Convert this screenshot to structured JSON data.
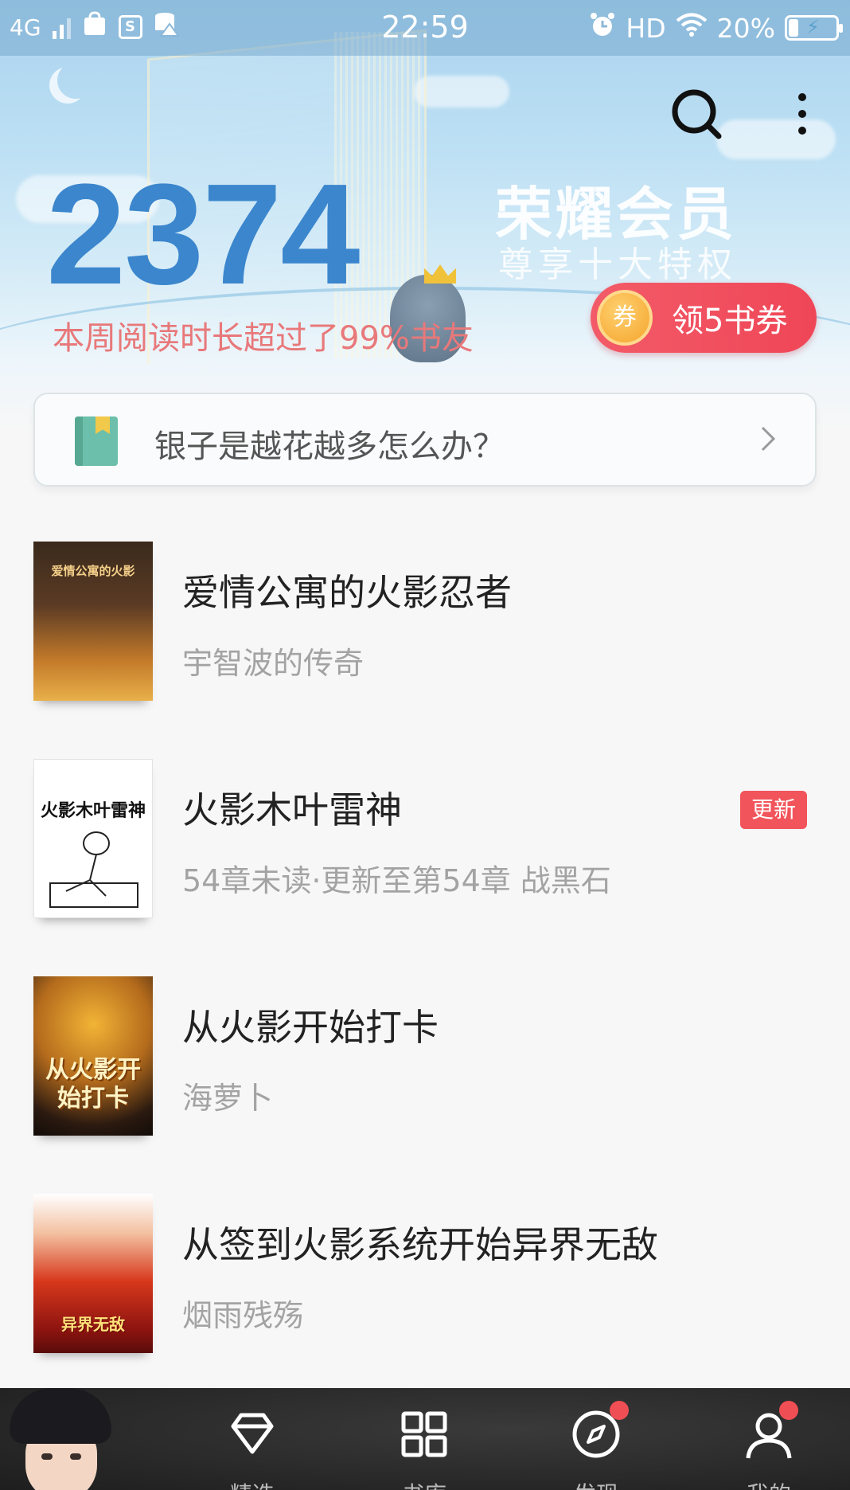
{
  "status_bar": {
    "network": "4G",
    "time": "22:59",
    "hd": "HD",
    "battery_percent": "20%",
    "battery_level": 0.2
  },
  "hero": {
    "reading_minutes": "2374",
    "reading_rank_text": "本周阅读时长超过了99%书友",
    "vip_title": "荣耀会员",
    "vip_subtitle": "尊享十大特权",
    "coupon_icon_label": "券",
    "coupon_label": "领5书券"
  },
  "tip": {
    "text": "银子是越花越多怎么办？"
  },
  "books": [
    {
      "title": "爱情公寓的火影忍者",
      "subtitle": "宇智波的传奇",
      "cover_text": "爱情公寓的火影",
      "badge": ""
    },
    {
      "title": "火影木叶雷神",
      "subtitle": "54章未读·更新至第54章 战黑石",
      "cover_text": "火影木叶雷神",
      "badge": "更新"
    },
    {
      "title": "从火影开始打卡",
      "subtitle": "海萝卜",
      "cover_text": "从火影开始打卡",
      "badge": ""
    },
    {
      "title": "从签到火影系统开始异界无敌",
      "subtitle": "烟雨残殇",
      "cover_text": "异界无敌",
      "badge": ""
    }
  ],
  "bottom_nav": {
    "tabs": [
      {
        "icon": "diamond-icon",
        "label": "精选"
      },
      {
        "icon": "grid-icon",
        "label": "书库"
      },
      {
        "icon": "compass-icon",
        "label": "发现"
      },
      {
        "icon": "person-icon",
        "label": "我的"
      }
    ]
  },
  "colors": {
    "accent_blue": "#3b86cd",
    "accent_red": "#f2545b",
    "rank_text": "#e8787a"
  }
}
